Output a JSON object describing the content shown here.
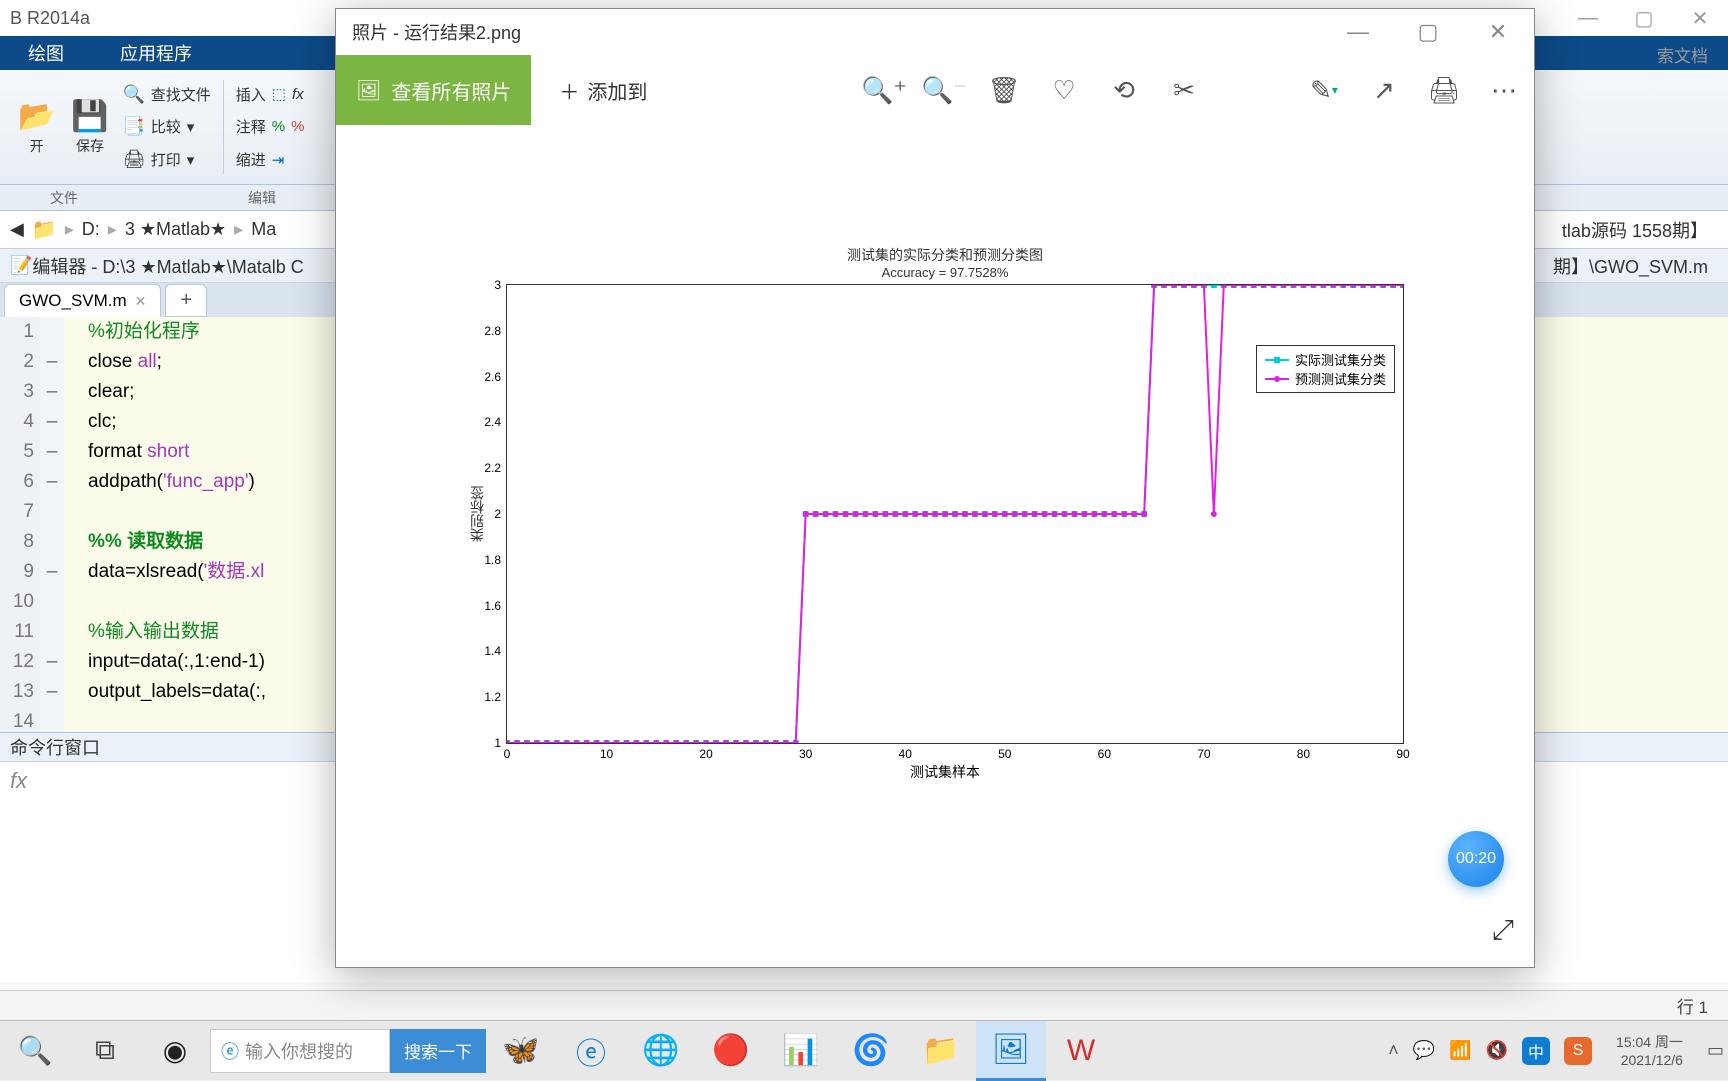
{
  "matlab": {
    "title": "B R2014a",
    "ribbon_tabs": [
      "绘图",
      "应用程序"
    ],
    "ribbon_search_hint": "索文档",
    "ribbon": {
      "open": "开",
      "save": "保存",
      "find_files": "查找文件",
      "compare": "比较",
      "print": "打印",
      "insert": "插入",
      "comment": "注释",
      "indent": "缩进",
      "file_label": "文件",
      "edit_label": "编辑"
    },
    "breadcrumbs": [
      "D:",
      "3 ★Matlab★",
      "Ma"
    ],
    "breadcrumb_right": "tlab源码 1558期】",
    "editor_title": "编辑器 - D:\\3 ★Matlab★\\Matalb C",
    "editor_right": "期】\\GWO_SVM.m",
    "tab_name": "GWO_SVM.m",
    "code": [
      {
        "n": 1,
        "m": "",
        "html": "<span class='c-comment'>%初始化程序</span>"
      },
      {
        "n": 2,
        "m": "–",
        "html": "close <span class='c-str'>all</span>;"
      },
      {
        "n": 3,
        "m": "–",
        "html": "clear;"
      },
      {
        "n": 4,
        "m": "–",
        "html": "clc;"
      },
      {
        "n": 5,
        "m": "–",
        "html": "format <span class='c-str'>short</span>"
      },
      {
        "n": 6,
        "m": "–",
        "html": "addpath(<span class='c-str'>'func_app'</span>)"
      },
      {
        "n": 7,
        "m": "",
        "html": ""
      },
      {
        "n": 8,
        "m": "",
        "html": "<span class='c-sec'>%% 读取数据</span>"
      },
      {
        "n": 9,
        "m": "–",
        "html": "data=xlsread(<span class='c-str'>'数据.xl</span>"
      },
      {
        "n": 10,
        "m": "",
        "html": ""
      },
      {
        "n": 11,
        "m": "",
        "html": "<span class='c-comment'>%输入输出数据</span>"
      },
      {
        "n": 12,
        "m": "–",
        "html": "input=data(:,1:end-1)"
      },
      {
        "n": 13,
        "m": "–",
        "html": "output_labels=data(:,"
      },
      {
        "n": 14,
        "m": "",
        "html": ""
      }
    ],
    "cmd_title": "命令行窗口",
    "cmd_prompt": "fx",
    "status": "行 1"
  },
  "photos": {
    "title": "照片 - 运行结果2.png",
    "see_all": "查看所有照片",
    "add_to": "添加到",
    "timer": "00:20"
  },
  "chart_data": {
    "type": "line",
    "title": "测试集的实际分类和预测分类图",
    "subtitle": "Accuracy = 97.7528%",
    "xlabel": "测试集样本",
    "ylabel": "类别标签",
    "xlim": [
      0,
      90
    ],
    "ylim": [
      1,
      3
    ],
    "xticks": [
      0,
      10,
      20,
      30,
      40,
      50,
      60,
      70,
      80,
      90
    ],
    "yticks": [
      1,
      1.2,
      1.4,
      1.6,
      1.8,
      2,
      2.2,
      2.4,
      2.6,
      2.8,
      3
    ],
    "series": [
      {
        "name": "实际测试集分类",
        "color": "#00d0d0",
        "marker": "square",
        "values": [
          1,
          1,
          1,
          1,
          1,
          1,
          1,
          1,
          1,
          1,
          1,
          1,
          1,
          1,
          1,
          1,
          1,
          1,
          1,
          1,
          1,
          1,
          1,
          1,
          1,
          1,
          1,
          1,
          1,
          1,
          2,
          2,
          2,
          2,
          2,
          2,
          2,
          2,
          2,
          2,
          2,
          2,
          2,
          2,
          2,
          2,
          2,
          2,
          2,
          2,
          2,
          2,
          2,
          2,
          2,
          2,
          2,
          2,
          2,
          2,
          2,
          2,
          2,
          2,
          2,
          3,
          3,
          3,
          3,
          3,
          3,
          3,
          3,
          3,
          3,
          3,
          3,
          3,
          3,
          3,
          3,
          3,
          3,
          3,
          3,
          3,
          3,
          3,
          3,
          3,
          3
        ]
      },
      {
        "name": "预测测试集分类",
        "color": "#e020e0",
        "marker": "circle",
        "values": [
          1,
          1,
          1,
          1,
          1,
          1,
          1,
          1,
          1,
          1,
          1,
          1,
          1,
          1,
          1,
          1,
          1,
          1,
          1,
          1,
          1,
          1,
          1,
          1,
          1,
          1,
          1,
          1,
          1,
          1,
          2,
          2,
          2,
          2,
          2,
          2,
          2,
          2,
          2,
          2,
          2,
          2,
          2,
          2,
          2,
          2,
          2,
          2,
          2,
          2,
          2,
          2,
          2,
          2,
          2,
          2,
          2,
          2,
          2,
          2,
          2,
          2,
          2,
          2,
          2,
          3,
          3,
          3,
          3,
          3,
          3,
          2,
          3,
          3,
          3,
          3,
          3,
          3,
          3,
          3,
          3,
          3,
          3,
          3,
          3,
          3,
          3,
          3,
          3,
          3,
          3
        ]
      }
    ],
    "legend_labels": [
      "实际测试集分类",
      "预测测试集分类"
    ]
  },
  "taskbar": {
    "search_placeholder": "输入你想搜的",
    "search_btn": "搜索一下",
    "time": "15:04",
    "day": "周一",
    "date": "2021/12/6",
    "ime": "中"
  }
}
